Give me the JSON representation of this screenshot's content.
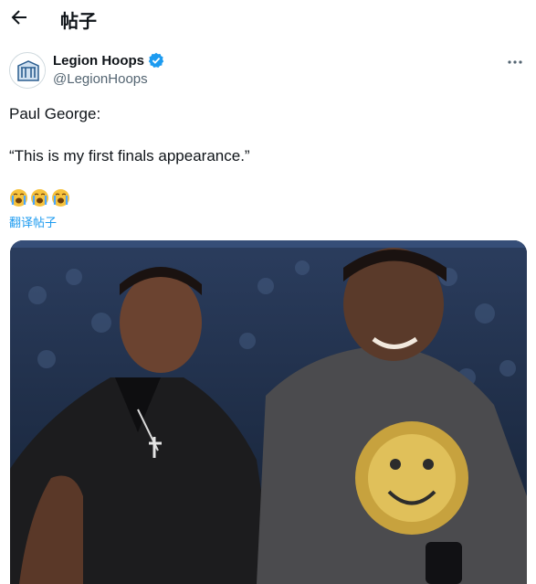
{
  "header": {
    "title": "帖子"
  },
  "author": {
    "name": "Legion Hoops",
    "handle": "@LegionHoops",
    "verified": true
  },
  "tweet": {
    "line1": "Paul George:",
    "line2": "“This is my first finals appearance.”",
    "emojis": [
      "loudly-crying-face",
      "loudly-crying-face",
      "loudly-crying-face"
    ],
    "translate_label": "翻译帖子"
  },
  "media": {
    "type": "image",
    "description_icon": "video-still"
  },
  "colors": {
    "accent": "#1d9bf0",
    "text": "#0f1419",
    "muted": "#536471"
  }
}
